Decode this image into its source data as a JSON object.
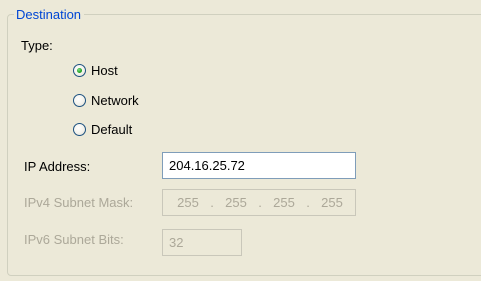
{
  "destination": {
    "legend": "Destination",
    "type_label": "Type:",
    "options": [
      {
        "label": "Host",
        "checked": true
      },
      {
        "label": "Network",
        "checked": false
      },
      {
        "label": "Default",
        "checked": false
      }
    ],
    "ip_address": {
      "label": "IP Address:",
      "value": "204.16.25.72"
    },
    "ipv4_mask": {
      "label": "IPv4 Subnet Mask:",
      "octets": [
        "255",
        "255",
        "255",
        "255"
      ],
      "separator": "."
    },
    "ipv6_bits": {
      "label": "IPv6 Subnet Bits:",
      "value": "32"
    }
  }
}
